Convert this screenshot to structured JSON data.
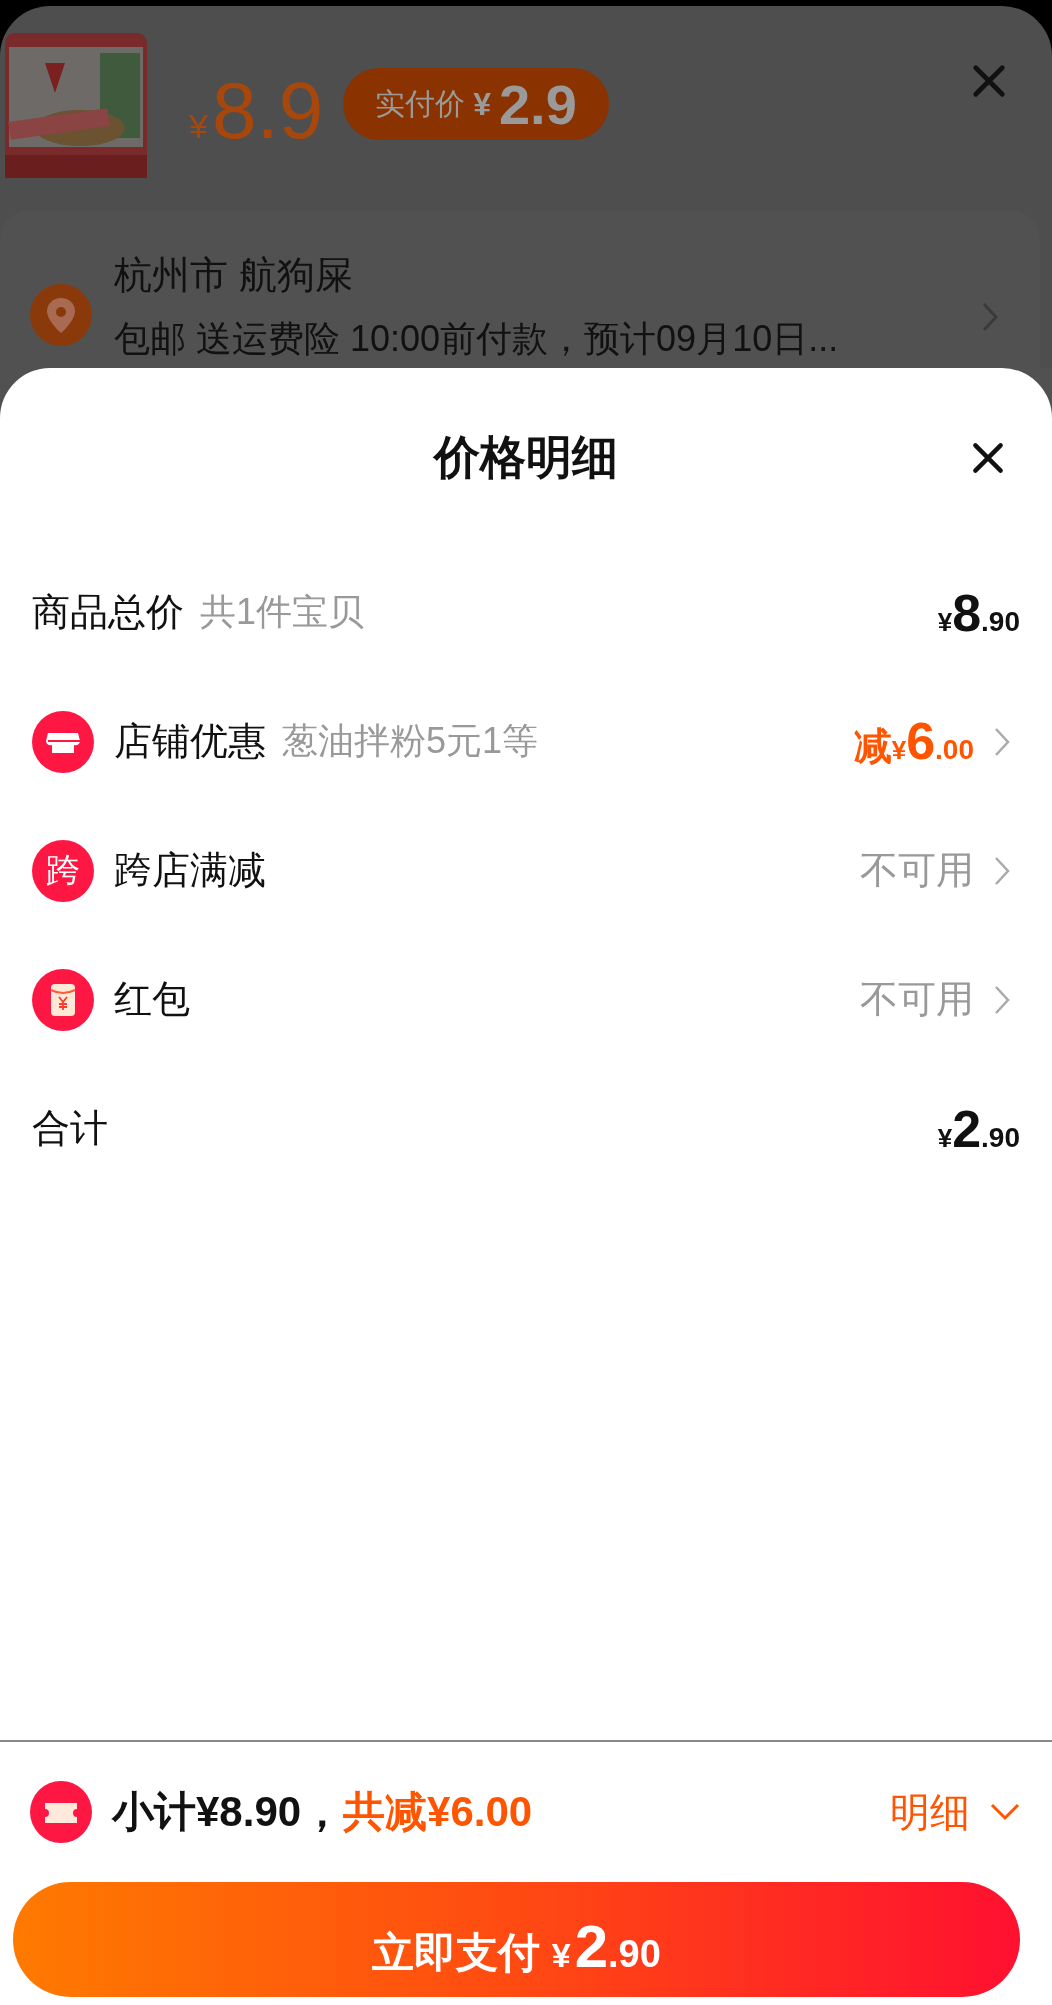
{
  "background_page": {
    "price": {
      "currency": "¥",
      "amount": "8.9"
    },
    "paid_badge": {
      "label": "实付价",
      "currency": "¥",
      "amount": "2.9"
    },
    "address": {
      "line": "杭州市 航狗屎",
      "shipping": "包邮 送运费险 10:00前付款，预计09月10日..."
    }
  },
  "sheet": {
    "title": "价格明细",
    "rows": [
      {
        "kind": "price",
        "label": "商品总价",
        "note": "共1件宝贝",
        "amount": {
          "currency": "¥",
          "integer": "8",
          "decimal": ".90"
        }
      },
      {
        "kind": "discount",
        "label": "店铺优惠",
        "note": "葱油拌粉5元1等",
        "prefix": "减",
        "amount": {
          "currency": "¥",
          "integer": "6",
          "decimal": ".00"
        }
      },
      {
        "kind": "status",
        "icon_text": "跨",
        "label": "跨店满减",
        "status": "不可用"
      },
      {
        "kind": "status",
        "label": "红包",
        "status": "不可用"
      },
      {
        "kind": "price",
        "label": "合计",
        "amount": {
          "currency": "¥",
          "integer": "2",
          "decimal": ".90"
        }
      }
    ]
  },
  "footer": {
    "subtotal": "小计¥8.90，",
    "saving": "共减¥6.00",
    "detail_link": "明细",
    "pay_button": {
      "label": "立即支付",
      "currency": "¥",
      "integer": "2",
      "decimal": ".90"
    }
  }
}
